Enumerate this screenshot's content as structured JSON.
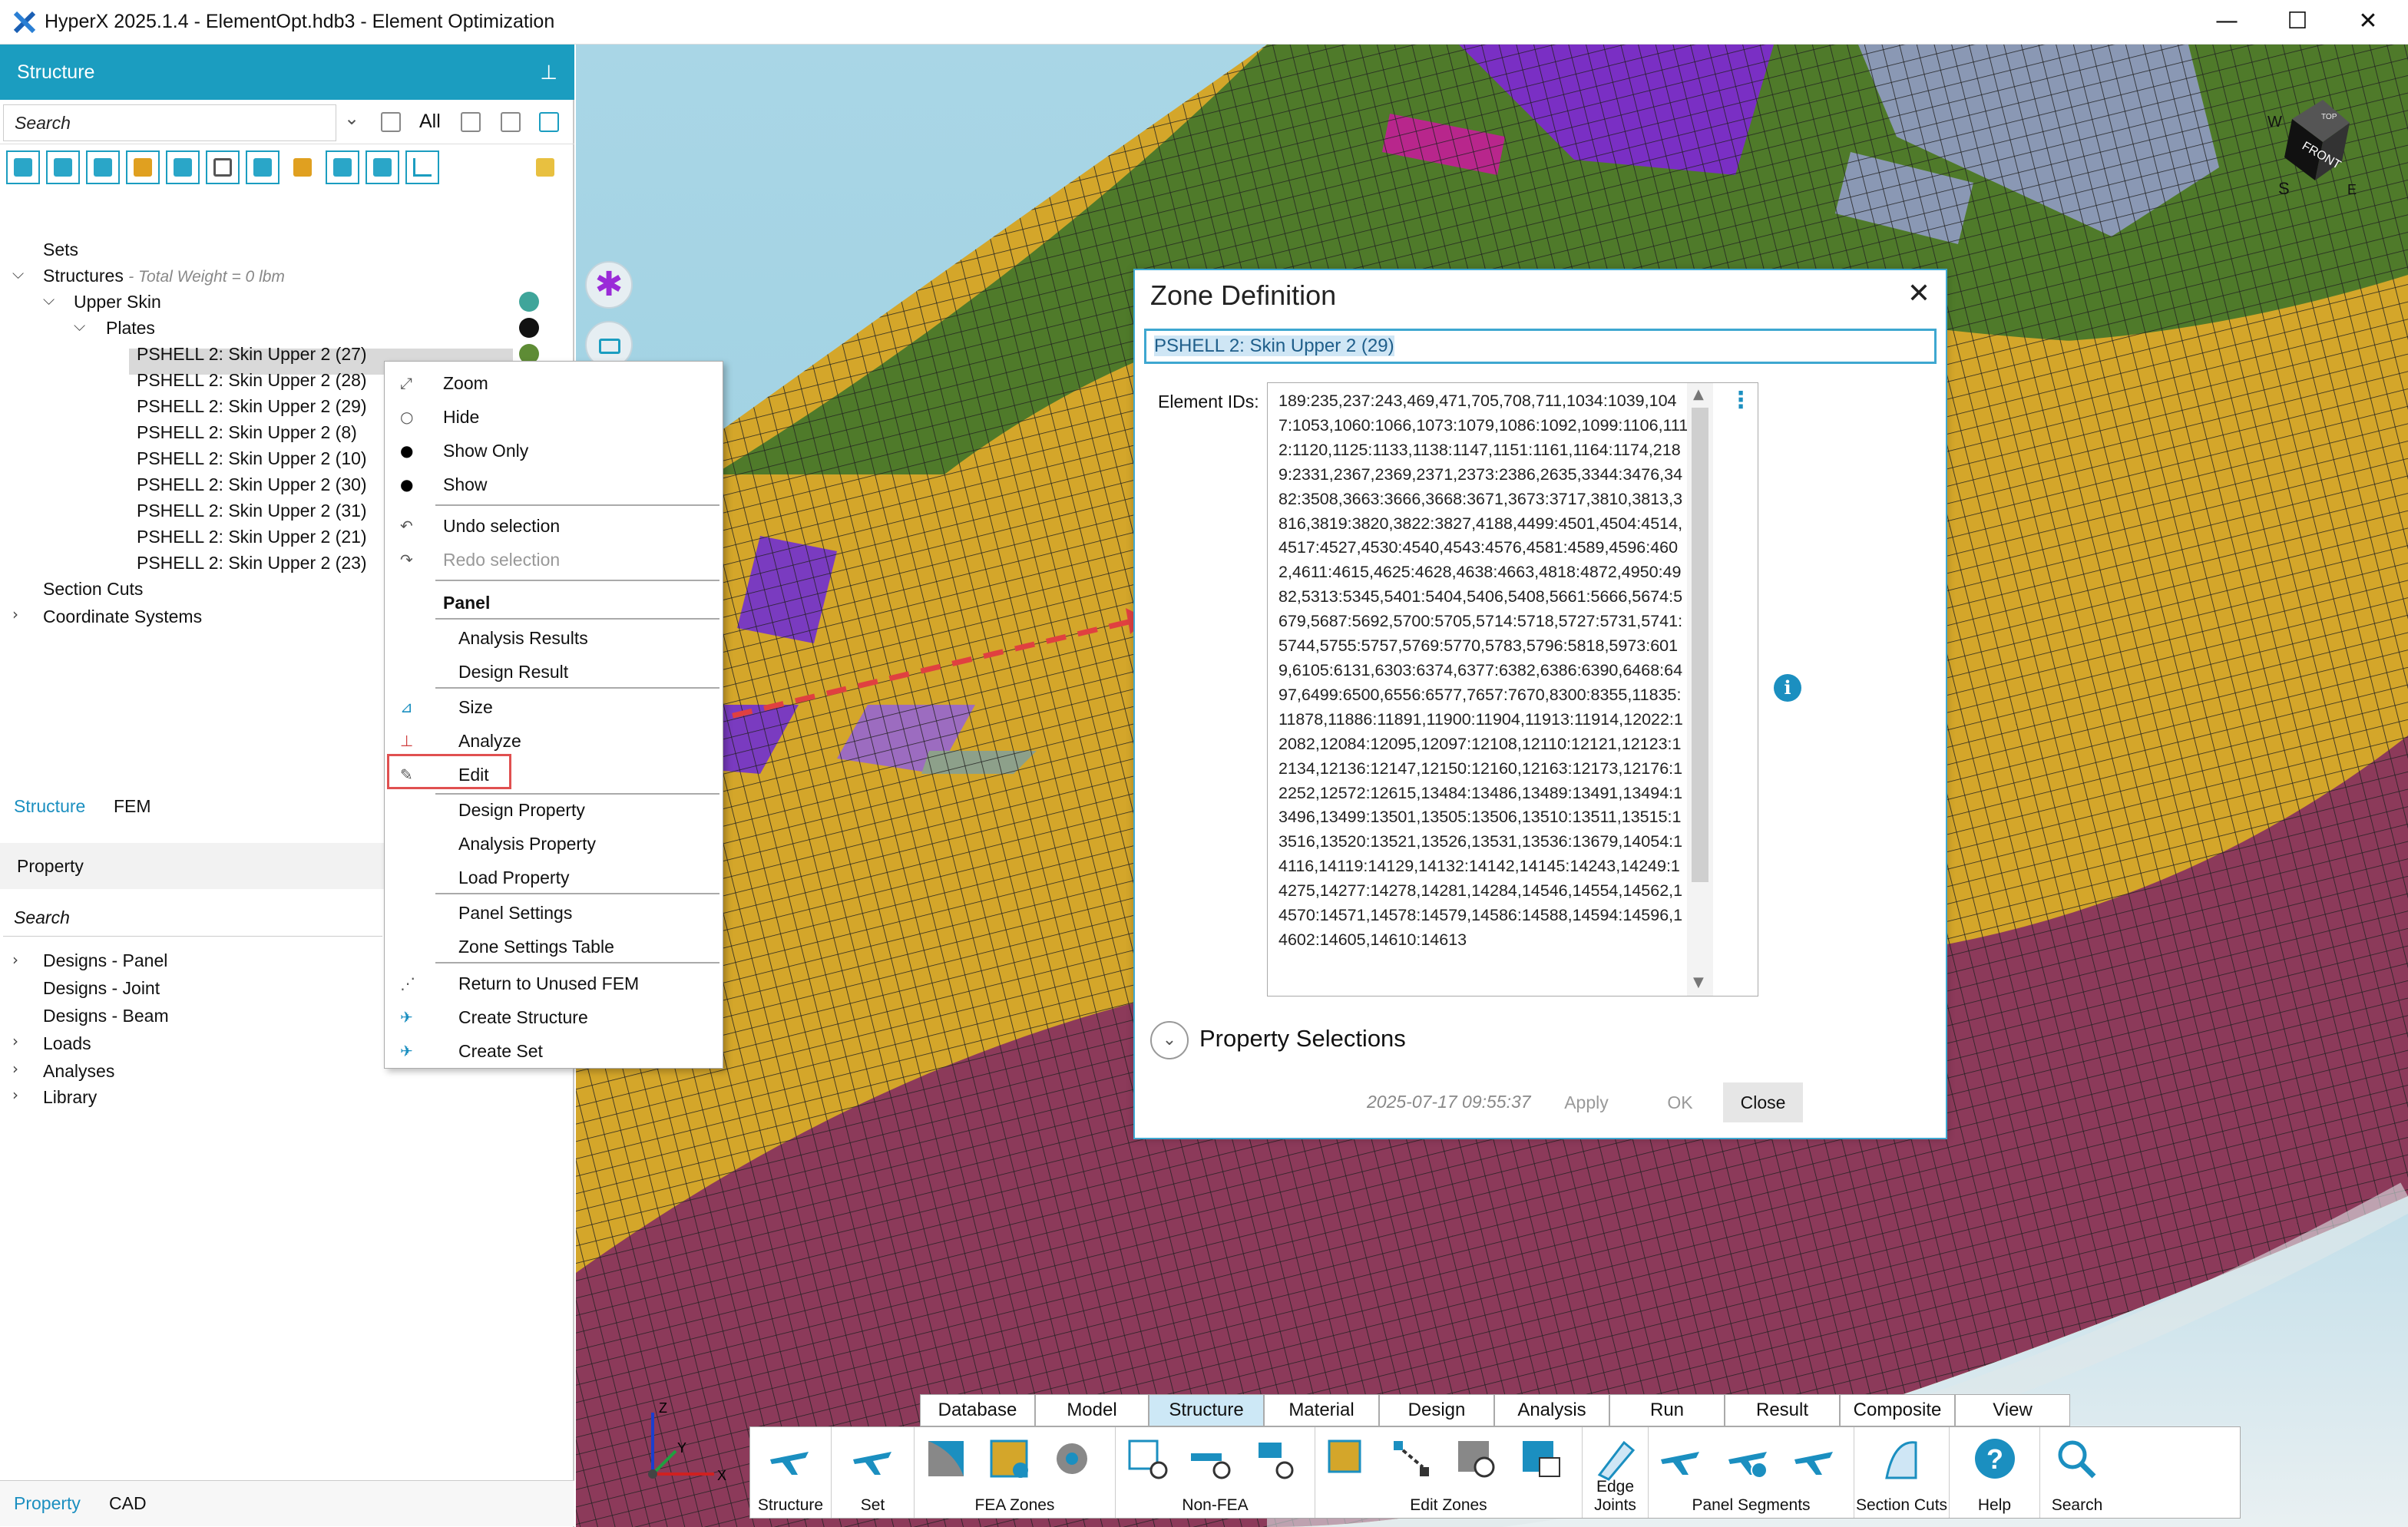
{
  "window": {
    "title": "HyperX 2025.1.4 - ElementOpt.hdb3 - Element Optimization",
    "minimize": "—",
    "maximize": "☐",
    "close": "✕"
  },
  "structure_panel": {
    "header": "Structure",
    "pin": "📌",
    "search_placeholder": "Search",
    "filter_all": "All",
    "tree": {
      "sets": "Sets",
      "structures": "Structures",
      "total_weight": "- Total Weight = 0 lbm",
      "upper_skin": "Upper Skin",
      "plates": "Plates",
      "items": [
        {
          "label": "PSHELL 2: Skin Upper 2 (27)",
          "color": "#5e8c35"
        },
        {
          "label": "PSHELL 2: Skin Upper 2 (28)",
          "color": "#8a98b4"
        },
        {
          "label": "PSHELL 2: Skin Upper 2 (29)",
          "color": ""
        },
        {
          "label": "PSHELL 2: Skin Upper 2 (8)",
          "color": ""
        },
        {
          "label": "PSHELL 2: Skin Upper 2 (10)",
          "color": ""
        },
        {
          "label": "PSHELL 2: Skin Upper 2 (30)",
          "color": ""
        },
        {
          "label": "PSHELL 2: Skin Upper 2 (31)",
          "color": ""
        },
        {
          "label": "PSHELL 2: Skin Upper 2 (21)",
          "color": ""
        },
        {
          "label": "PSHELL 2: Skin Upper 2 (23)",
          "color": ""
        }
      ],
      "section_cuts": "Section Cuts",
      "coordinate_systems": "Coordinate Systems"
    },
    "tabs": [
      "Structure",
      "FEM"
    ]
  },
  "property_panel": {
    "header": "Property",
    "search_placeholder": "Search",
    "items": [
      "Designs - Panel",
      "Designs - Joint",
      "Designs - Beam",
      "Loads",
      "Analyses",
      "Library"
    ],
    "bottom_tabs": [
      "Property",
      "CAD"
    ]
  },
  "context_menu": {
    "items": [
      {
        "label": "Zoom",
        "icon": "zoom-icon",
        "disabled": false
      },
      {
        "label": "Hide",
        "icon": "circle-outline-icon",
        "disabled": false
      },
      {
        "label": "Show Only",
        "icon": "circle-filled-icon",
        "disabled": false
      },
      {
        "label": "Show",
        "icon": "circle-filled-icon",
        "disabled": false
      },
      {
        "label": "Undo selection",
        "icon": "undo-icon",
        "disabled": false
      },
      {
        "label": "Redo selection",
        "icon": "redo-icon",
        "disabled": true
      }
    ],
    "panel_header": "Panel",
    "panel_items": [
      "Analysis Results",
      "Design Result",
      "Size",
      "Analyze",
      "Edit",
      "Design Property",
      "Analysis Property",
      "Load Property",
      "Panel Settings",
      "Zone Settings Table",
      "Return to Unused FEM",
      "Create Structure",
      "Create Set"
    ]
  },
  "dialog": {
    "title": "Zone Definition",
    "close": "✕",
    "name_value": "PSHELL 2: Skin Upper 2 (29)",
    "element_ids_label": "Element IDs:",
    "element_ids": "189:235,237:243,469,471,705,708,711,1034:1039,1047:1053,1060:1066,1073:1079,1086:1092,1099:1106,1112:1120,1125:1133,1138:1147,1151:1161,1164:1174,2189:2331,2367,2369,2371,2373:2386,2635,3344:3476,3482:3508,3663:3666,3668:3671,3673:3717,3810,3813,3816,3819:3820,3822:3827,4188,4499:4501,4504:4514,4517:4527,4530:4540,4543:4576,4581:4589,4596:4602,4611:4615,4625:4628,4638:4663,4818:4872,4950:4982,5313:5345,5401:5404,5406,5408,5661:5666,5674:5679,5687:5692,5700:5705,5714:5718,5727:5731,5741:5744,5755:5757,5769:5770,5783,5796:5818,5973:6019,6105:6131,6303:6374,6377:6382,6386:6390,6468:6497,6499:6500,6556:6577,7657:7670,8300:8355,11835:11878,11886:11891,11900:11904,11913:11914,12022:12082,12084:12095,12097:12108,12110:12121,12123:12134,12136:12147,12150:12160,12163:12173,12176:12252,12572:12615,13484:13486,13489:13491,13494:13496,13499:13501,13505:13506,13510:13511,13515:13516,13520:13521,13526,13531,13536:13679,14054:14116,14119:14129,14132:14142,14145:14243,14249:14275,14277:14278,14281,14284,14546,14554,14562,14570:14571,14578:14579,14586:14588,14594:14596,14602:14605,14610:14613",
    "property_selections": "Property Selections",
    "timestamp": "2025-07-17 09:55:37",
    "apply": "Apply",
    "ok": "OK",
    "close_btn": "Close"
  },
  "ribbon": {
    "tabs": [
      "Database",
      "Model",
      "Structure",
      "Material",
      "Design",
      "Analysis",
      "Run",
      "Result",
      "Composite",
      "View"
    ],
    "active_tab": "Structure",
    "groups": [
      {
        "label": "Structure"
      },
      {
        "label": "Set"
      },
      {
        "label": "FEA Zones"
      },
      {
        "label": "Non-FEA"
      },
      {
        "label": "Edit Zones"
      },
      {
        "label": "Edge Joints"
      },
      {
        "label": "Panel Segments"
      },
      {
        "label": "Section Cuts"
      },
      {
        "label": "Help"
      },
      {
        "label": "Search"
      }
    ]
  },
  "viewcube": {
    "front": "FRONT",
    "top": "TOP",
    "w": "W",
    "s": "S",
    "e": "E"
  },
  "axes": {
    "x": "X",
    "y": "Y",
    "z": "Z"
  },
  "colors": {
    "accent": "#1b9dc0",
    "mesh_green": "#4f7a2a",
    "mesh_gold": "#d8aa2a",
    "mesh_maroon": "#8c3a5a",
    "mesh_purple": "#7a2fc4",
    "mesh_slate": "#8a98b4",
    "arrow_red": "#e04040"
  }
}
